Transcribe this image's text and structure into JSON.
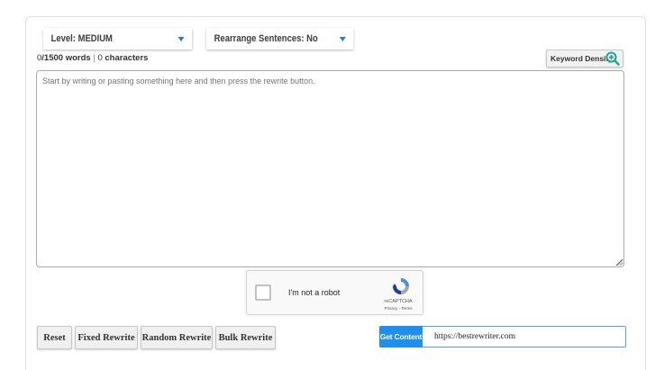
{
  "controls": {
    "level_dropdown": "Level: MEDIUM",
    "rearrange_dropdown": "Rearrange Sentences: No"
  },
  "counter": {
    "words": "0",
    "words_suffix": "/1500 words",
    "separator": "|",
    "characters": "0",
    "characters_suffix": "characters"
  },
  "keyword_density": {
    "label": "Keyword Density",
    "icon": "zoom-in-icon"
  },
  "editor": {
    "placeholder": "Start by writing or pasting something here and then press the rewrite button.",
    "value": ""
  },
  "captcha": {
    "label": "I'm not a robot",
    "brand": "reCAPTCHA",
    "terms": "Privacy - Terms"
  },
  "actions": {
    "reset": "Reset",
    "fixed_rewrite": "Fixed Rewrite",
    "random_rewrite": "Random Rewrite",
    "bulk_rewrite": "Bulk Rewrite"
  },
  "get_content": {
    "button": "Get Content",
    "url": "https://bestrewriter.com"
  },
  "colors": {
    "accent": "#1e8ef0",
    "caret": "#1a7fd0",
    "kd_icon": "#17a589"
  }
}
